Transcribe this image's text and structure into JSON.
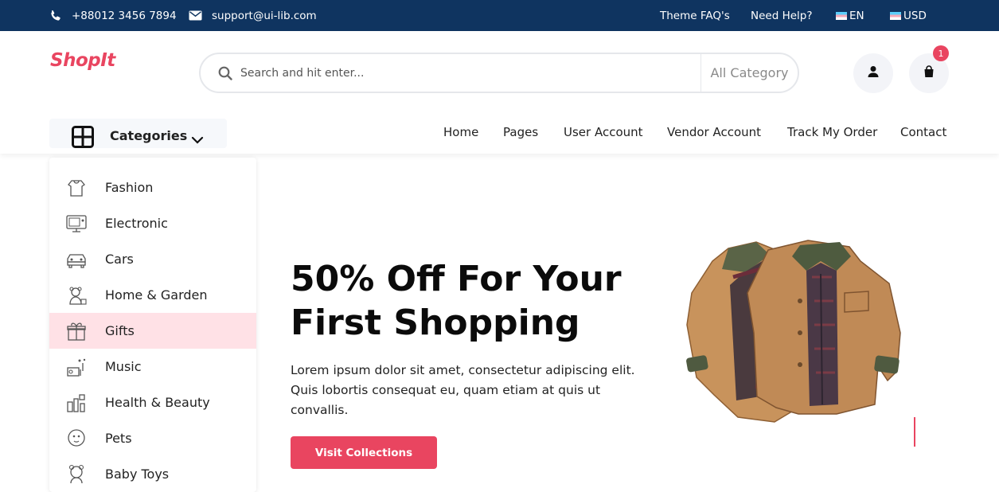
{
  "topbar": {
    "phone": "+88012 3456 7894",
    "email": "support@ui-lib.com",
    "links": [
      "Theme FAQ's",
      "Need Help?"
    ],
    "language": "EN",
    "currency": "USD"
  },
  "brand": {
    "logo": "ShopIt",
    "accent": "#e94560",
    "navy": "#0f3460"
  },
  "search": {
    "placeholder": "Search and hit enter...",
    "category": "All Category"
  },
  "cart": {
    "count": "1"
  },
  "categories_button": {
    "label": "Categories"
  },
  "nav": [
    "Home",
    "Pages",
    "User Account",
    "Vendor Account",
    "Track My Order",
    "Contact"
  ],
  "menu": {
    "active_index": 4,
    "items": [
      {
        "label": "Fashion",
        "icon": "fashion-icon"
      },
      {
        "label": "Electronic",
        "icon": "electronic-icon"
      },
      {
        "label": "Cars",
        "icon": "car-icon"
      },
      {
        "label": "Home & Garden",
        "icon": "home-garden-icon"
      },
      {
        "label": "Gifts",
        "icon": "gift-icon"
      },
      {
        "label": "Music",
        "icon": "music-icon"
      },
      {
        "label": "Health & Beauty",
        "icon": "health-beauty-icon"
      },
      {
        "label": "Pets",
        "icon": "pets-icon"
      },
      {
        "label": "Baby Toys",
        "icon": "baby-toys-icon"
      }
    ]
  },
  "hero": {
    "title": "50% Off For Your First Shopping",
    "description": "Lorem ipsum dolor sit amet, consectetur adipiscing elit. Quis lobortis consequat eu, quam etiam at quis ut convallis.",
    "cta": "Visit Collections"
  }
}
